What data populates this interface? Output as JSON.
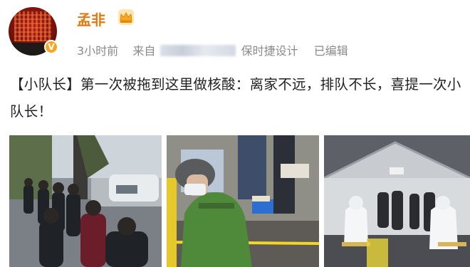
{
  "user": {
    "name": "孟非",
    "verified_badge": "V",
    "badge_color": "#f5a623",
    "name_color": "#e8760e"
  },
  "meta": {
    "time": "3小时前",
    "source_prefix": "来自",
    "source_name": "保时捷设计",
    "edited": "已编辑"
  },
  "post": {
    "text": "【小队长】第一次被拖到这里做核酸：离家不远，排队不长，喜提一次小队长！"
  },
  "photos": [
    {
      "subject": "queue-on-street"
    },
    {
      "subject": "man-in-green-jacket-at-testing-booth"
    },
    {
      "subject": "testing-tent-with-medical-staff"
    }
  ]
}
